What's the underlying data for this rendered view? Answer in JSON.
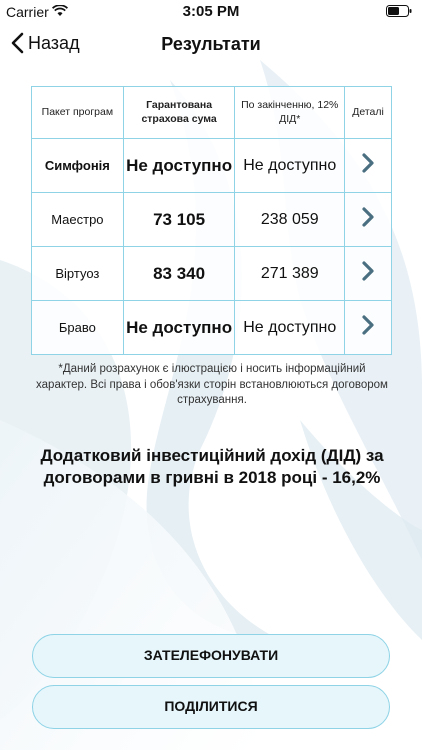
{
  "status_bar": {
    "carrier": "Carrier",
    "time": "3:05 PM"
  },
  "nav": {
    "back_label": "Назад",
    "title": "Результати"
  },
  "table": {
    "headers": {
      "package": "Пакет програм",
      "sum": "Гарантована страхова сума",
      "end": "По закінченню, 12% ДІД*",
      "details": "Деталі"
    },
    "rows": [
      {
        "name": "Симфонія",
        "sum": "Не доступно",
        "end": "Не доступно"
      },
      {
        "name": "Маестро",
        "sum": "73 105",
        "end": "238 059"
      },
      {
        "name": "Віртуоз",
        "sum": "83 340",
        "end": "271 389"
      },
      {
        "name": "Браво",
        "sum": "Не доступно",
        "end": "Не доступно"
      }
    ]
  },
  "note": "*Даний розрахунок є ілюстрацією і носить інформаційний характер. Всі права і обов'язки сторін встановлюються договором страхування.",
  "income_text": "Додатковий інвестиційний дохід (ДІД) за договорами в гривні в 2018 році - 16,2%",
  "buttons": {
    "call": "ЗАТЕЛЕФОНУВАТИ",
    "share": "ПОДІЛИТИСЯ"
  },
  "colors": {
    "accent_border": "#8fd3e6",
    "button_bg": "#e6f6fb",
    "chevron": "#4a6f80"
  }
}
